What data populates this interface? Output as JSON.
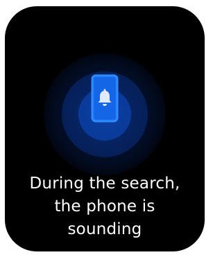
{
  "screen": {
    "background_color": "#000000",
    "accent_color": "#1f7bff",
    "icon": "phone-ringing-icon",
    "message_lines": [
      "During the search,",
      "the phone is",
      "sounding"
    ]
  }
}
